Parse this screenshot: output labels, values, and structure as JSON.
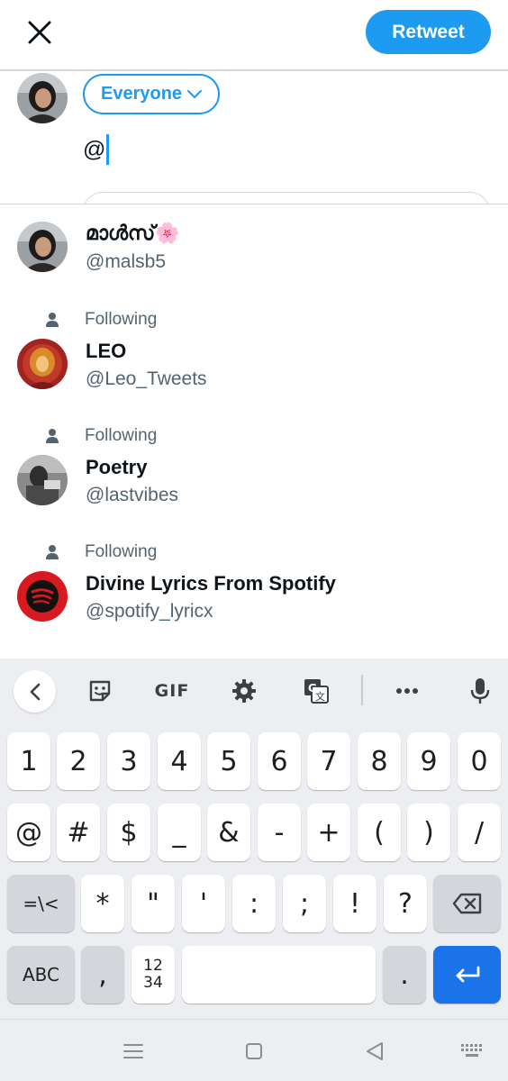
{
  "header": {
    "retweet_label": "Retweet",
    "close_icon": "close-icon"
  },
  "composer": {
    "audience_label": "Everyone",
    "text_value": "@"
  },
  "suggestions": [
    {
      "name": "മാൾസ്🌸",
      "handle": "@malsb5",
      "following": false,
      "avatar_color": "#6b6f73"
    },
    {
      "name": "LEO",
      "handle": "@Leo_Tweets",
      "following": true,
      "following_label": "Following",
      "avatar_color": "#a3231f"
    },
    {
      "name": "Poetry",
      "handle": "@lastvibes",
      "following": true,
      "following_label": "Following",
      "avatar_color": "#5a5a5a"
    },
    {
      "name": "Divine Lyrics From Spotify",
      "handle": "@spotify_lyricx",
      "following": true,
      "following_label": "Following",
      "avatar_color": "#d71920"
    }
  ],
  "keyboard": {
    "toolbar": {
      "gif_label": "GIF",
      "icons": [
        "back-chevron-icon",
        "sticker-icon",
        "gif-icon",
        "settings-gear-icon",
        "translate-icon",
        "more-icon",
        "microphone-icon"
      ]
    },
    "row1": [
      "1",
      "2",
      "3",
      "4",
      "5",
      "6",
      "7",
      "8",
      "9",
      "0"
    ],
    "row2": [
      "@",
      "#",
      "$",
      "_",
      "&",
      "-",
      "+",
      "(",
      ")",
      "/"
    ],
    "row3": [
      "=\\<",
      "*",
      "\"",
      "'",
      ":",
      ";",
      "!",
      "?"
    ],
    "row4": {
      "abc_label": "ABC",
      "comma": ",",
      "numpad_top": "12",
      "numpad_bottom": "34",
      "period": "."
    }
  },
  "colors": {
    "accent": "#1d9bf0",
    "secondary_text": "#536471",
    "enter_key": "#1a73e8",
    "keyboard_bg": "#eceef1"
  }
}
